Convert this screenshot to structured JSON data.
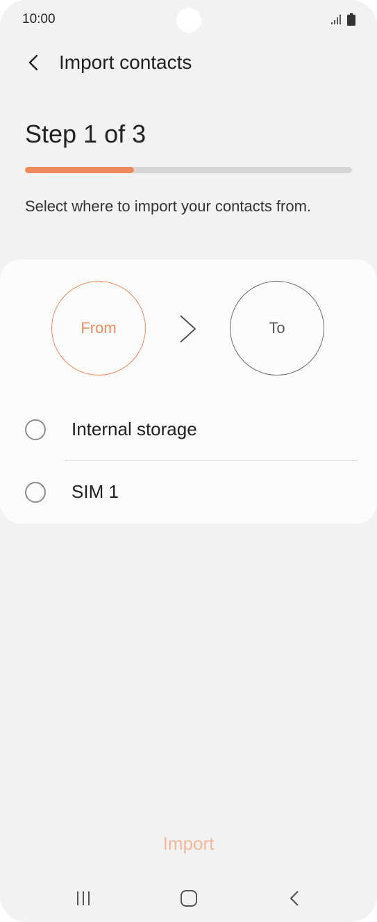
{
  "status_bar": {
    "time": "10:00",
    "icons": [
      "camera-cutout",
      "signal-icon",
      "battery-icon"
    ]
  },
  "header": {
    "back_icon": "chevron-left-icon",
    "title": "Import contacts"
  },
  "step": {
    "title": "Step 1 of 3",
    "progress_percent": 33.3,
    "instruction": "Select where to import your contacts from."
  },
  "card": {
    "from_label": "From",
    "to_label": "To",
    "arrow_icon": "chevron-right-icon",
    "options": [
      {
        "label": "Internal storage",
        "selected": false
      },
      {
        "label": "SIM 1",
        "selected": false
      }
    ]
  },
  "actions": {
    "import_label": "Import"
  },
  "nav": {
    "items": [
      "recent-apps-icon",
      "home-icon",
      "back-icon"
    ]
  },
  "colors": {
    "accent": "#f08a5d",
    "accent_disabled": "#f3b99d",
    "background": "#f2f2f2",
    "card": "#fcfcfc",
    "progress_track": "#d6d6d6"
  }
}
